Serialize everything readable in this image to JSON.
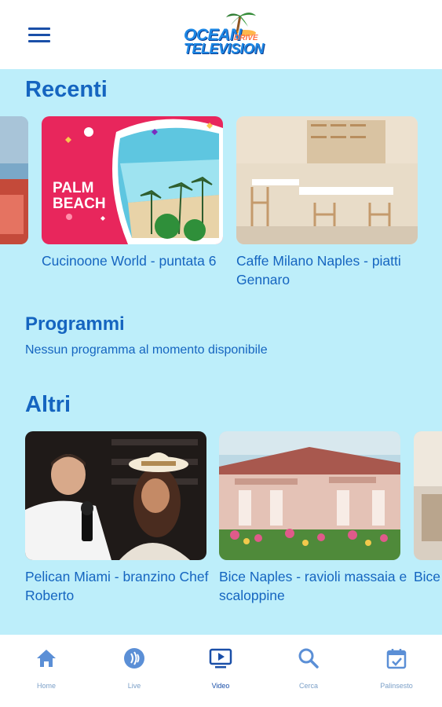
{
  "header": {
    "menu_icon": "hamburger-menu-icon",
    "logo": {
      "line1": "OCEAN",
      "line2": "TELEVISION",
      "small": "DRIVE"
    }
  },
  "sections": {
    "recenti": {
      "title": "Recenti",
      "items": [
        {
          "label": "Cucinoone World - puntata 6",
          "thumb_text": "PALM BEACH"
        },
        {
          "label": "Caffe Milano Naples - piatti Gennaro"
        }
      ]
    },
    "programmi": {
      "title": "Programmi",
      "empty_message": "Nessun programma al momento disponibile"
    },
    "altri": {
      "title": "Altri",
      "items": [
        {
          "label": "Pelican Miami - branzino Chef Roberto"
        },
        {
          "label": "Bice Naples - ravioli massaia e scaloppine"
        },
        {
          "label": "Bice"
        }
      ]
    }
  },
  "bottom_nav": {
    "items": [
      {
        "label": "Home",
        "icon": "home-icon",
        "active": false
      },
      {
        "label": "Live",
        "icon": "live-broadcast-icon",
        "active": false
      },
      {
        "label": "Video",
        "icon": "video-player-icon",
        "active": true
      },
      {
        "label": "Cerca",
        "icon": "search-icon",
        "active": false
      },
      {
        "label": "Palinsesto",
        "icon": "calendar-icon",
        "active": false
      }
    ]
  },
  "colors": {
    "background": "#bdeefa",
    "accent": "#1565c0",
    "nav_active": "#1a4fa8",
    "nav_inactive": "#7ca0c8"
  }
}
